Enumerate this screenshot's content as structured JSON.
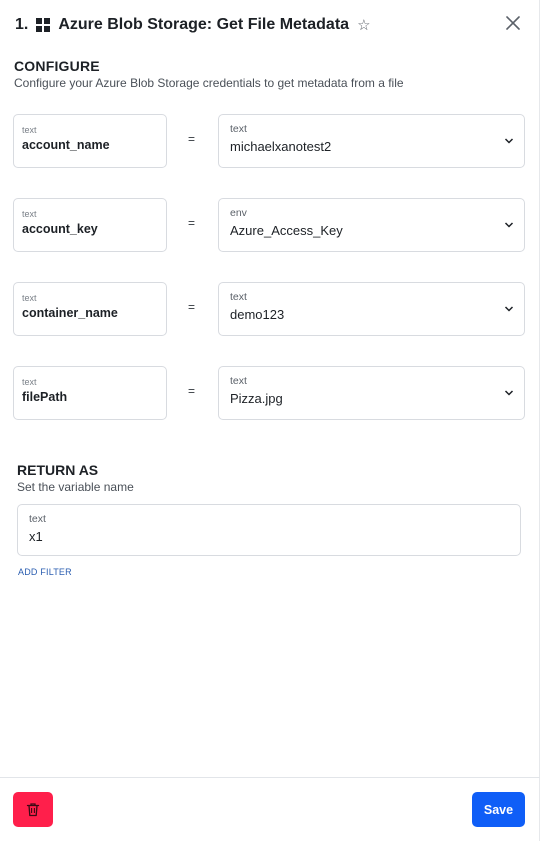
{
  "header": {
    "step_number": "1.",
    "title": "Azure Blob Storage: Get File Metadata"
  },
  "configure": {
    "title": "CONFIGURE",
    "description": "Configure your Azure Blob Storage credentials to get metadata from a file",
    "rows": [
      {
        "left_type": "text",
        "left_value": "account_name",
        "operator": "=",
        "right_type": "text",
        "right_value": "michaelxanotest2"
      },
      {
        "left_type": "text",
        "left_value": "account_key",
        "operator": "=",
        "right_type": "env",
        "right_value": "Azure_Access_Key"
      },
      {
        "left_type": "text",
        "left_value": "container_name",
        "operator": "=",
        "right_type": "text",
        "right_value": "demo123"
      },
      {
        "left_type": "text",
        "left_value": "filePath",
        "operator": "=",
        "right_type": "text",
        "right_value": "Pizza.jpg"
      }
    ]
  },
  "return_as": {
    "title": "RETURN AS",
    "description": "Set the variable name",
    "type": "text",
    "value": "x1",
    "add_filter_label": "ADD FILTER"
  },
  "footer": {
    "save_label": "Save",
    "delete_icon": "trash-icon"
  },
  "colors": {
    "delete": "#ff1f4b",
    "save": "#0f5ef7",
    "link": "#2a5db0"
  }
}
